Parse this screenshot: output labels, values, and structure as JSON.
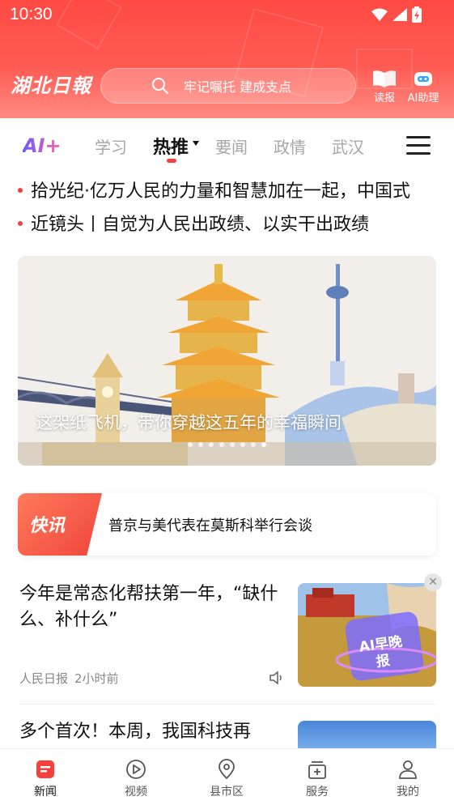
{
  "status_bar": {
    "time": "10:30"
  },
  "header": {
    "logo": "湖北日報",
    "search_placeholder": "牢记嘱托 建成支点",
    "read_paper_label": "读报",
    "ai_assistant_label": "AI助理"
  },
  "tabs": {
    "ai_logo": "AI+",
    "items": [
      "学习",
      "热推",
      "要闻",
      "政情",
      "武汉"
    ],
    "active": "热推"
  },
  "headlines": [
    {
      "text": "拾光纪·亿万人民的力量和智慧加在一起，中国式"
    },
    {
      "prefix": "近镜头",
      "text": "自觉为人民出政绩、以实干出政绩"
    }
  ],
  "banner": {
    "caption": "这架纸飞机，带你穿越这五年的幸福瞬间",
    "dot_count": 8,
    "active_dot": 7
  },
  "flash": {
    "badge": "快讯",
    "text": "普京与美代表在莫斯科举行会谈"
  },
  "news": [
    {
      "title": "今年是常态化帮扶第一年，“缺什么、补什么”",
      "source": "人民日报",
      "time": "2小时前",
      "thumb_badge": "AI早晚报"
    },
    {
      "title": "多个首次！本周，我国科技再"
    }
  ],
  "bottom_nav": [
    {
      "label": "新闻",
      "icon": "news-icon",
      "active": true
    },
    {
      "label": "视频",
      "icon": "video-play-icon",
      "active": false
    },
    {
      "label": "县市区",
      "icon": "location-pin-icon",
      "active": false
    },
    {
      "label": "服务",
      "icon": "service-box-icon",
      "active": false
    },
    {
      "label": "我的",
      "icon": "user-icon",
      "active": false
    }
  ],
  "colors": {
    "brand_red": "#f4413b",
    "header_gradient_top": "#ff4a43",
    "header_gradient_bottom": "#ff8a80"
  }
}
